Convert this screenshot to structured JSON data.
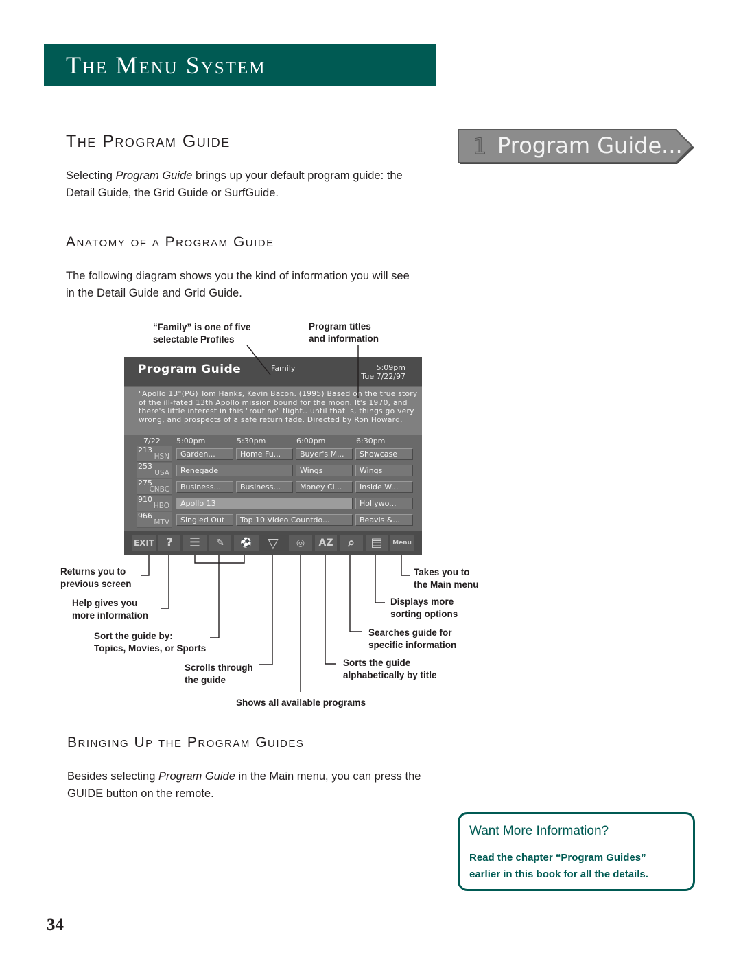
{
  "chapter": {
    "title": "The Menu System"
  },
  "sections": {
    "program_guide": {
      "heading": "The Program Guide",
      "text_before": "Selecting ",
      "text_em": "Program Guide",
      "text_after": " brings up your default program guide: the",
      "text_line2": "Detail Guide, the Grid Guide or SurfGuide."
    },
    "anatomy": {
      "heading": "Anatomy of a Program Guide",
      "line1": "The following diagram shows you the kind of information you will see",
      "line2": "in the Detail Guide and Grid Guide."
    },
    "bringing_up": {
      "heading": "Bringing Up the Program Guides",
      "text_before": "Besides selecting ",
      "text_em": "Program Guide",
      "text_after": " in the Main menu, you can press the",
      "line2": "GUIDE button on the remote."
    }
  },
  "menu_button": {
    "number": "1",
    "label": "Program Guide..."
  },
  "callouts": {
    "family_1": "“Family” is one of five",
    "family_2": "selectable Profiles",
    "titles_1": "Program titles",
    "titles_2": "and information",
    "returns_1": "Returns you to",
    "returns_2": "previous screen",
    "help_1": "Help gives you",
    "help_2": "more information",
    "sort_1": "Sort the guide by:",
    "sort_2": "Topics, Movies, or Sports",
    "scroll_1": "Scrolls through",
    "scroll_2": "the guide",
    "shows_all": "Shows all available programs",
    "alpha_1": "Sorts the guide",
    "alpha_2": "alphabetically by title",
    "search_1": "Searches guide for",
    "search_2": "specific information",
    "more_sort_1": "Displays more",
    "more_sort_2": "sorting options",
    "main_1": "Takes you to",
    "main_2": "the Main menu"
  },
  "tv_screen": {
    "title": "Program Guide",
    "profile": "Family",
    "time": "5:09pm",
    "date": "Tue 7/22/97",
    "description": "\"Apollo 13\"(PG) Tom Hanks, Kevin Bacon. (1995) Based on the true story of the ill-fated 13th Apollo mission bound for the moon. It's 1970, and there's little interest in this \"routine\" flight.. until that is, things go very wrong, and prospects of a safe return fade. Directed by Ron Howard.",
    "grid_date": "7/22",
    "time_slots": [
      "5:00pm",
      "5:30pm",
      "6:00pm",
      "6:30pm"
    ],
    "channels": [
      {
        "number": "213",
        "name": "HSN",
        "programs": [
          "Garden...",
          "Home Fu...",
          "Buyer's M...",
          "Showcase"
        ]
      },
      {
        "number": "253",
        "name": "USA",
        "programs": [
          "Renegade",
          "Wings",
          "Wings"
        ]
      },
      {
        "number": "275",
        "name": "CNBC",
        "programs": [
          "Business...",
          "Business...",
          "Money Cl...",
          "Inside W..."
        ]
      },
      {
        "number": "910",
        "name": "HBO",
        "programs": [
          "Apollo 13",
          "Hollywo..."
        ]
      },
      {
        "number": "966",
        "name": "MTV",
        "programs": [
          "Singled Out",
          "Top 10 Video Countdo...",
          "Beavis &..."
        ]
      }
    ],
    "toolbar": {
      "exit": "EXIT",
      "help": "?",
      "list": "☰",
      "topics": "✎",
      "categories": "⚽",
      "scroll": "▽",
      "all": "◎",
      "az": "AZ",
      "search": "⌕",
      "sort_more": "▤",
      "menu": "Menu"
    }
  },
  "info_box": {
    "title": "Want More Information?",
    "line1": "Read the chapter “Program Guides”",
    "line2": "earlier in this book for all the details."
  },
  "page_number": "34",
  "colors": {
    "brand": "#005a53",
    "screen_dark": "#4c4c4c",
    "screen_mid": "#666666"
  }
}
